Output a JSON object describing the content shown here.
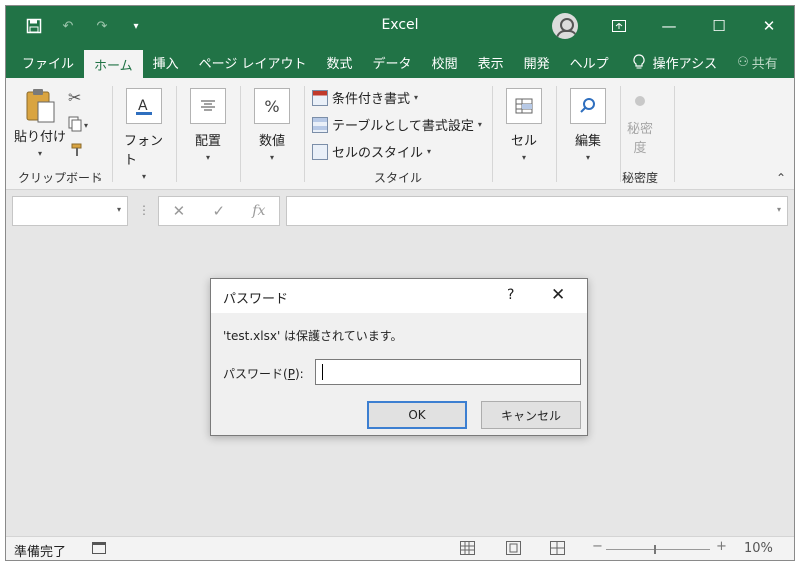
{
  "title_bar": {
    "app_title": "Excel",
    "qat_icons": [
      "save-icon",
      "undo-icon",
      "redo-icon",
      "customize-icon"
    ]
  },
  "ribbon_tabs": {
    "file": "ファイル",
    "home": "ホーム",
    "insert": "挿入",
    "page_layout": "ページ レイアウト",
    "formulas": "数式",
    "data": "データ",
    "review": "校閲",
    "view": "表示",
    "developer": "開発",
    "help": "ヘルプ",
    "tell_me": "操作アシス",
    "share": "共有"
  },
  "ribbon": {
    "paste": "貼り付け",
    "clipboard_group": "クリップボード",
    "font": "フォント",
    "alignment": "配置",
    "number": "数値",
    "conditional_formatting": "条件付き書式",
    "format_as_table": "テーブルとして書式設定",
    "cell_styles": "セルのスタイル",
    "styles_group": "スタイル",
    "cells": "セル",
    "editing": "編集",
    "sensitivity_line1": "秘密",
    "sensitivity_line2": "度",
    "sensitivity_group": "秘密度"
  },
  "formula_bar": {
    "fx_label": "fx"
  },
  "dialog": {
    "title": "パスワード",
    "help": "?",
    "message": "'test.xlsx' は保護されています。",
    "password_label": "パスワード(P):",
    "password_value": "",
    "ok": "OK",
    "cancel": "キャンセル"
  },
  "status_bar": {
    "status": "準備完了",
    "zoom": "10%"
  },
  "colors": {
    "excel_green": "#217346",
    "ribbon_bg": "#f3f3f3",
    "ok_focus": "#3c7fd1"
  }
}
